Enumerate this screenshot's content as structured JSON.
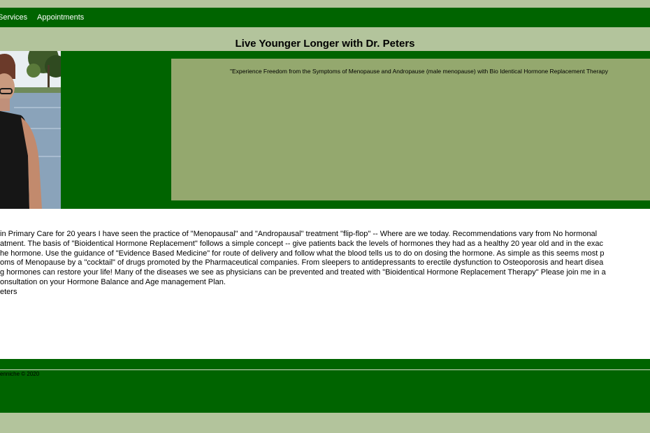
{
  "nav": {
    "items": [
      {
        "label": "Services"
      },
      {
        "label": "Appointments"
      }
    ]
  },
  "header": {
    "title": "Live Younger Longer with Dr. Peters"
  },
  "hero": {
    "quote": "\"Experience Freedom from the Symptoms of Menopause and Andropause (male menopause) with Bio Identical Hormone Replacement Therapy"
  },
  "content": {
    "lines": [
      "in Primary Care for 20 years I have seen the practice of \"Menopausal\" and \"Andropausal\" treatment \"flip-flop\" -- Where are we today. Recommendations vary from No hormonal",
      "atment. The basis of \"Bioidentical Hormone Replacement\" follows a simple concept -- give patients back the levels of hormones they had as a healthy 20 year old and in the exac",
      "he hormone. Use the guidance of \"Evidence Based Medicine\" for route of delivery and follow what the blood tells us to do on dosing the hormone. As simple as this seems most p",
      "oms of Menopause by a \"cocktail\" of drugs promoted by the Pharmaceutical companies. From sleepers to antidepressants to erectile dysfunction to Osteoporosis and heart disea",
      "g hormones can restore your life! Many of the diseases we see as physicians can be prevented and treated with \"Bioidentical Hormone Replacement Therapy\" Please join me in a",
      "onsultation on your Hormone Balance and Age management Plan.",
      "eters"
    ]
  },
  "footer": {
    "copyright": "enniche © 2020"
  },
  "colors": {
    "background": "#b3c49c",
    "brand_green": "#006400",
    "quote_box": "#94a86e",
    "content_bg": "#ffffff"
  }
}
